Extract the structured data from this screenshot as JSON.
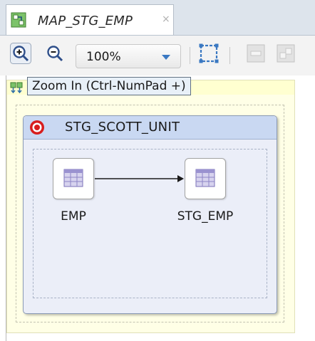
{
  "tab": {
    "title": "MAP_STG_EMP",
    "close_label": "×",
    "icon": "mapping-icon"
  },
  "toolbar": {
    "zoom_in_icon": "zoom-in-icon",
    "zoom_out_icon": "zoom-out-icon",
    "zoom_value": "100%",
    "fit_icon": "fit-to-window-icon",
    "disabled_buttons": [
      "layout-icon",
      "auto-layout-icon"
    ]
  },
  "tooltip": {
    "text": "Zoom In (Ctrl-NumPad +)"
  },
  "diagram": {
    "unit": {
      "title": "STG_SCOTT_UNIT",
      "icon": "execution-unit-icon"
    },
    "nodes": [
      {
        "label": "EMP",
        "icon": "table-icon"
      },
      {
        "label": "STG_EMP",
        "icon": "table-icon"
      }
    ]
  },
  "colors": {
    "tab_strip": "#dde4ec",
    "unit_header": "#c9d8f2",
    "outer_fill": "#ffffe6",
    "tooltip_bg": "#e8f0f8"
  }
}
